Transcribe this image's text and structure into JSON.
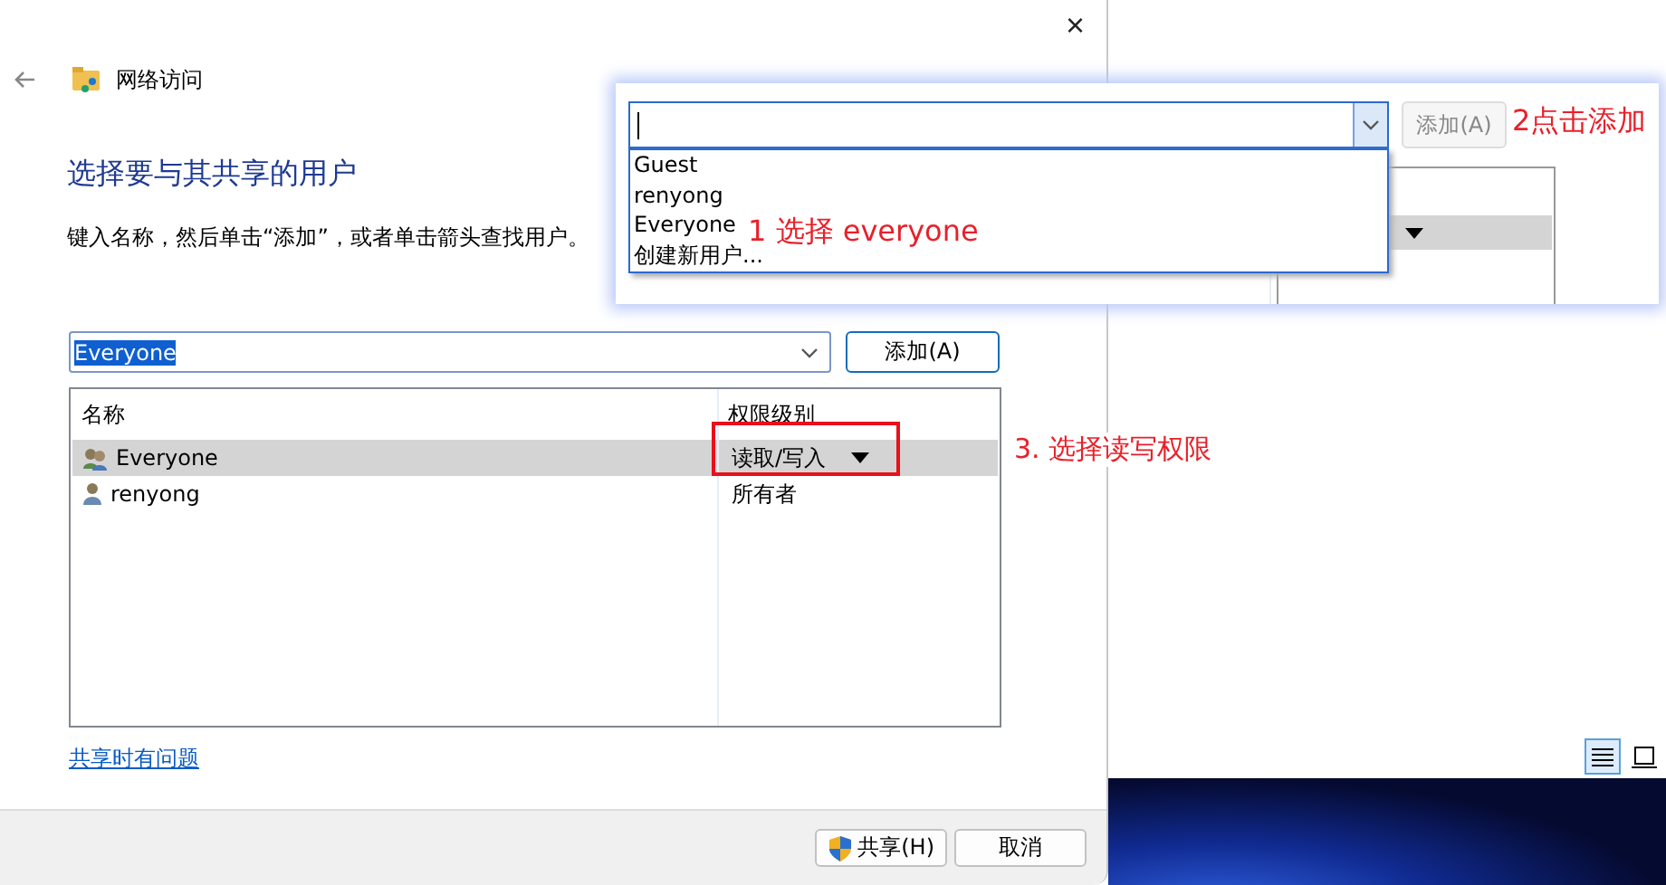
{
  "dialog": {
    "close": "×",
    "title": "网络访问",
    "heading": "选择要与其共享的用户",
    "instruction": "键入名称，然后单击“添加”，或者单击箭头查找用户。",
    "name_field": {
      "value": "Everyone"
    },
    "add_button": "添加(A)",
    "table": {
      "columns": [
        "名称",
        "权限级别"
      ],
      "rows": [
        {
          "name": "Everyone",
          "kind": "group",
          "permission": "读取/写入",
          "dropdown": true,
          "selected": true
        },
        {
          "name": "renyong",
          "kind": "user",
          "permission": "所有者",
          "dropdown": false,
          "selected": false
        }
      ]
    },
    "help_link": "共享时有问题",
    "buttons": [
      {
        "label": "共享(H)",
        "kind": "shield"
      },
      {
        "label": "取消",
        "kind": "plain"
      }
    ]
  },
  "annotation": "3. 选择读写权限",
  "inset": {
    "add_button": {
      "label": "添加(A)",
      "disabled": true
    },
    "dropdown_items": [
      "Guest",
      "renyong",
      "Everyone",
      "创建新用户..."
    ],
    "annotations": [
      "1 选择 everyone",
      "2点击添加"
    ]
  }
}
